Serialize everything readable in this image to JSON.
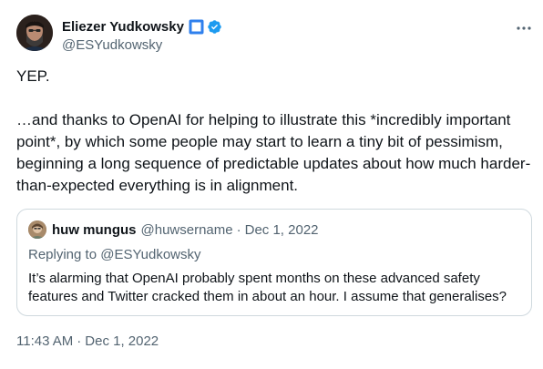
{
  "author": {
    "display_name": "Eliezer Yudkowsky",
    "handle": "@ESYudkowsky",
    "avatar_icon": "user-avatar",
    "badges": [
      "square-emoji-icon",
      "verified-icon"
    ],
    "verified_color": "#1d9bf0"
  },
  "more_icon": "more-horizontal-icon",
  "tweet": {
    "line1": "YEP.",
    "line2": "…and thanks to OpenAI for helping to illustrate this *incredibly important point*, by which some people may start to learn a tiny bit of pessimism, beginning a long sequence of predictable updates about how much harder-than-expected everything is in alignment."
  },
  "quote": {
    "display_name": "huw mungus",
    "handle": "@huwsername",
    "separator": "·",
    "date": "Dec 1, 2022",
    "replying_prefix": "Replying to ",
    "replying_handle": "@ESYudkowsky",
    "text": "It’s alarming that OpenAI probably spent months on these advanced safety features and Twitter cracked them in about an hour. I assume that generalises?"
  },
  "timestamp": {
    "time": "11:43 AM",
    "separator": "·",
    "date": "Dec 1, 2022"
  },
  "colors": {
    "text": "#0f1419",
    "secondary": "#536471",
    "border": "#cfd9de",
    "accent": "#1d9bf0"
  }
}
